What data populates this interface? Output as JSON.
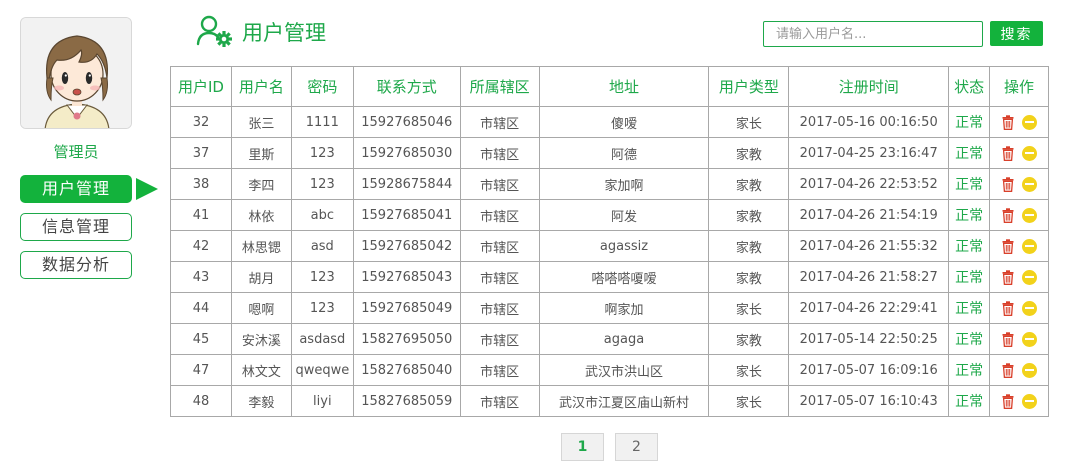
{
  "sidebar": {
    "role": "管理员",
    "nav": [
      {
        "label": "用户管理",
        "active": true
      },
      {
        "label": "信息管理",
        "active": false
      },
      {
        "label": "数据分析",
        "active": false
      }
    ]
  },
  "header": {
    "title": "用户管理",
    "icon": "user-settings-icon",
    "search_placeholder": "请输入用户名...",
    "search_button": "搜索"
  },
  "table": {
    "headers": [
      "用户ID",
      "用户名",
      "密码",
      "联系方式",
      "所属辖区",
      "地址",
      "用户类型",
      "注册时间",
      "状态",
      "操作"
    ],
    "rows": [
      [
        "32",
        "张三",
        "1111",
        "15927685046",
        "市辖区",
        "傻嗳",
        "家长",
        "2017-05-16 00:16:50",
        "正常"
      ],
      [
        "37",
        "里斯",
        "123",
        "15927685030",
        "市辖区",
        "阿德",
        "家教",
        "2017-04-25 23:16:47",
        "正常"
      ],
      [
        "38",
        "李四",
        "123",
        "15928675844",
        "市辖区",
        "家加啊",
        "家教",
        "2017-04-26 22:53:52",
        "正常"
      ],
      [
        "41",
        "林依",
        "abc",
        "15927685041",
        "市辖区",
        "阿发",
        "家教",
        "2017-04-26 21:54:19",
        "正常"
      ],
      [
        "42",
        "林思锶",
        "asd",
        "15927685042",
        "市辖区",
        "agassiz",
        "家教",
        "2017-04-26 21:55:32",
        "正常"
      ],
      [
        "43",
        "胡月",
        "123",
        "15927685043",
        "市辖区",
        "嗒嗒嗒嗄嗳",
        "家教",
        "2017-04-26 21:58:27",
        "正常"
      ],
      [
        "44",
        "嗯啊",
        "123",
        "15927685049",
        "市辖区",
        "啊家加",
        "家长",
        "2017-04-26 22:29:41",
        "正常"
      ],
      [
        "45",
        "安沐溪",
        "asdasd",
        "15827695050",
        "市辖区",
        "agaga",
        "家教",
        "2017-05-14 22:50:25",
        "正常"
      ],
      [
        "47",
        "林文文",
        "qweqwe",
        "15827685040",
        "市辖区",
        "武汉市洪山区",
        "家长",
        "2017-05-07 16:09:16",
        "正常"
      ],
      [
        "48",
        "李毅",
        "liyi",
        "15827685059",
        "市辖区",
        "武汉市江夏区庙山新村",
        "家长",
        "2017-05-07 16:10:43",
        "正常"
      ]
    ],
    "row_actions": [
      "trash-icon",
      "disable-icon"
    ]
  },
  "pagination": {
    "pages": [
      "1",
      "2"
    ],
    "current": "1"
  },
  "colors": {
    "accent": "#13b23c",
    "text_green": "#1ea84a",
    "delete_red": "#d9402b",
    "disable_yellow": "#f2d21b"
  }
}
